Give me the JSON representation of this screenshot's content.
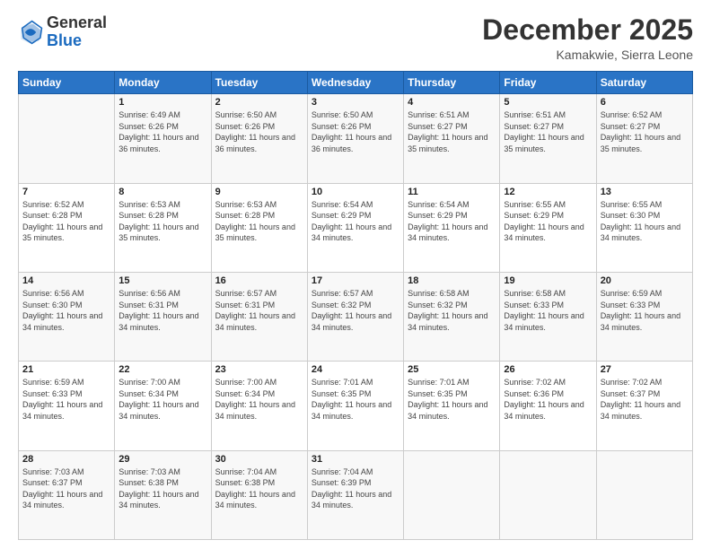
{
  "logo": {
    "general": "General",
    "blue": "Blue"
  },
  "title": "December 2025",
  "location": "Kamakwie, Sierra Leone",
  "days_header": [
    "Sunday",
    "Monday",
    "Tuesday",
    "Wednesday",
    "Thursday",
    "Friday",
    "Saturday"
  ],
  "weeks": [
    [
      {
        "day": "",
        "sunrise": "",
        "sunset": "",
        "daylight": ""
      },
      {
        "day": "1",
        "sunrise": "Sunrise: 6:49 AM",
        "sunset": "Sunset: 6:26 PM",
        "daylight": "Daylight: 11 hours and 36 minutes."
      },
      {
        "day": "2",
        "sunrise": "Sunrise: 6:50 AM",
        "sunset": "Sunset: 6:26 PM",
        "daylight": "Daylight: 11 hours and 36 minutes."
      },
      {
        "day": "3",
        "sunrise": "Sunrise: 6:50 AM",
        "sunset": "Sunset: 6:26 PM",
        "daylight": "Daylight: 11 hours and 36 minutes."
      },
      {
        "day": "4",
        "sunrise": "Sunrise: 6:51 AM",
        "sunset": "Sunset: 6:27 PM",
        "daylight": "Daylight: 11 hours and 35 minutes."
      },
      {
        "day": "5",
        "sunrise": "Sunrise: 6:51 AM",
        "sunset": "Sunset: 6:27 PM",
        "daylight": "Daylight: 11 hours and 35 minutes."
      },
      {
        "day": "6",
        "sunrise": "Sunrise: 6:52 AM",
        "sunset": "Sunset: 6:27 PM",
        "daylight": "Daylight: 11 hours and 35 minutes."
      }
    ],
    [
      {
        "day": "7",
        "sunrise": "Sunrise: 6:52 AM",
        "sunset": "Sunset: 6:28 PM",
        "daylight": "Daylight: 11 hours and 35 minutes."
      },
      {
        "day": "8",
        "sunrise": "Sunrise: 6:53 AM",
        "sunset": "Sunset: 6:28 PM",
        "daylight": "Daylight: 11 hours and 35 minutes."
      },
      {
        "day": "9",
        "sunrise": "Sunrise: 6:53 AM",
        "sunset": "Sunset: 6:28 PM",
        "daylight": "Daylight: 11 hours and 35 minutes."
      },
      {
        "day": "10",
        "sunrise": "Sunrise: 6:54 AM",
        "sunset": "Sunset: 6:29 PM",
        "daylight": "Daylight: 11 hours and 34 minutes."
      },
      {
        "day": "11",
        "sunrise": "Sunrise: 6:54 AM",
        "sunset": "Sunset: 6:29 PM",
        "daylight": "Daylight: 11 hours and 34 minutes."
      },
      {
        "day": "12",
        "sunrise": "Sunrise: 6:55 AM",
        "sunset": "Sunset: 6:29 PM",
        "daylight": "Daylight: 11 hours and 34 minutes."
      },
      {
        "day": "13",
        "sunrise": "Sunrise: 6:55 AM",
        "sunset": "Sunset: 6:30 PM",
        "daylight": "Daylight: 11 hours and 34 minutes."
      }
    ],
    [
      {
        "day": "14",
        "sunrise": "Sunrise: 6:56 AM",
        "sunset": "Sunset: 6:30 PM",
        "daylight": "Daylight: 11 hours and 34 minutes."
      },
      {
        "day": "15",
        "sunrise": "Sunrise: 6:56 AM",
        "sunset": "Sunset: 6:31 PM",
        "daylight": "Daylight: 11 hours and 34 minutes."
      },
      {
        "day": "16",
        "sunrise": "Sunrise: 6:57 AM",
        "sunset": "Sunset: 6:31 PM",
        "daylight": "Daylight: 11 hours and 34 minutes."
      },
      {
        "day": "17",
        "sunrise": "Sunrise: 6:57 AM",
        "sunset": "Sunset: 6:32 PM",
        "daylight": "Daylight: 11 hours and 34 minutes."
      },
      {
        "day": "18",
        "sunrise": "Sunrise: 6:58 AM",
        "sunset": "Sunset: 6:32 PM",
        "daylight": "Daylight: 11 hours and 34 minutes."
      },
      {
        "day": "19",
        "sunrise": "Sunrise: 6:58 AM",
        "sunset": "Sunset: 6:33 PM",
        "daylight": "Daylight: 11 hours and 34 minutes."
      },
      {
        "day": "20",
        "sunrise": "Sunrise: 6:59 AM",
        "sunset": "Sunset: 6:33 PM",
        "daylight": "Daylight: 11 hours and 34 minutes."
      }
    ],
    [
      {
        "day": "21",
        "sunrise": "Sunrise: 6:59 AM",
        "sunset": "Sunset: 6:33 PM",
        "daylight": "Daylight: 11 hours and 34 minutes."
      },
      {
        "day": "22",
        "sunrise": "Sunrise: 7:00 AM",
        "sunset": "Sunset: 6:34 PM",
        "daylight": "Daylight: 11 hours and 34 minutes."
      },
      {
        "day": "23",
        "sunrise": "Sunrise: 7:00 AM",
        "sunset": "Sunset: 6:34 PM",
        "daylight": "Daylight: 11 hours and 34 minutes."
      },
      {
        "day": "24",
        "sunrise": "Sunrise: 7:01 AM",
        "sunset": "Sunset: 6:35 PM",
        "daylight": "Daylight: 11 hours and 34 minutes."
      },
      {
        "day": "25",
        "sunrise": "Sunrise: 7:01 AM",
        "sunset": "Sunset: 6:35 PM",
        "daylight": "Daylight: 11 hours and 34 minutes."
      },
      {
        "day": "26",
        "sunrise": "Sunrise: 7:02 AM",
        "sunset": "Sunset: 6:36 PM",
        "daylight": "Daylight: 11 hours and 34 minutes."
      },
      {
        "day": "27",
        "sunrise": "Sunrise: 7:02 AM",
        "sunset": "Sunset: 6:37 PM",
        "daylight": "Daylight: 11 hours and 34 minutes."
      }
    ],
    [
      {
        "day": "28",
        "sunrise": "Sunrise: 7:03 AM",
        "sunset": "Sunset: 6:37 PM",
        "daylight": "Daylight: 11 hours and 34 minutes."
      },
      {
        "day": "29",
        "sunrise": "Sunrise: 7:03 AM",
        "sunset": "Sunset: 6:38 PM",
        "daylight": "Daylight: 11 hours and 34 minutes."
      },
      {
        "day": "30",
        "sunrise": "Sunrise: 7:04 AM",
        "sunset": "Sunset: 6:38 PM",
        "daylight": "Daylight: 11 hours and 34 minutes."
      },
      {
        "day": "31",
        "sunrise": "Sunrise: 7:04 AM",
        "sunset": "Sunset: 6:39 PM",
        "daylight": "Daylight: 11 hours and 34 minutes."
      },
      {
        "day": "",
        "sunrise": "",
        "sunset": "",
        "daylight": ""
      },
      {
        "day": "",
        "sunrise": "",
        "sunset": "",
        "daylight": ""
      },
      {
        "day": "",
        "sunrise": "",
        "sunset": "",
        "daylight": ""
      }
    ]
  ]
}
